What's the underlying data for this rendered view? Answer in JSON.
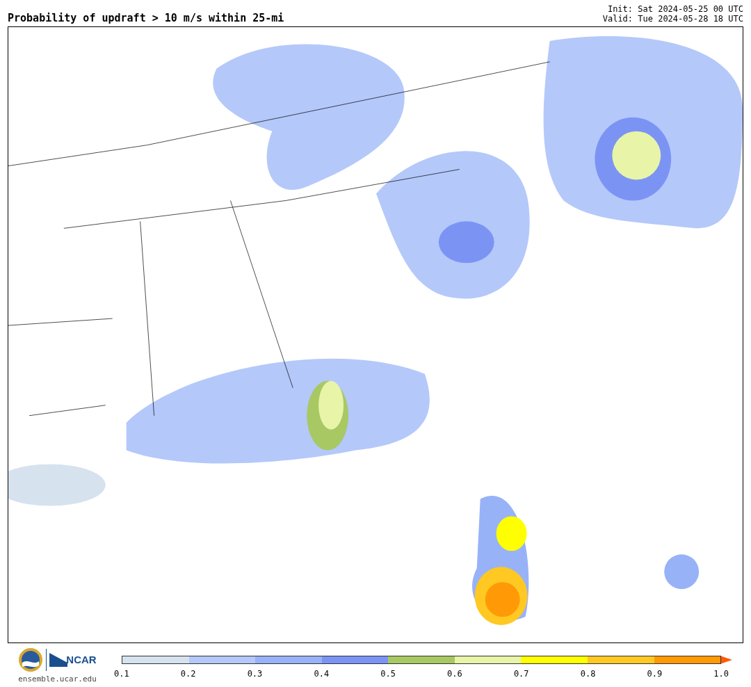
{
  "title": "Probability of updraft > 10 m/s within 25-mi",
  "init": "Init: Sat 2024-05-25 00 UTC",
  "valid": "Valid: Tue 2024-05-28 18 UTC",
  "footer": {
    "logo_text": "NCAR",
    "site": "ensemble.ucar.edu"
  },
  "colorbar": {
    "segments": [
      {
        "color": "#d6e2ee"
      },
      {
        "color": "#b4c8fa"
      },
      {
        "color": "#98b2f8"
      },
      {
        "color": "#7b94f4"
      },
      {
        "color": "#a8c864"
      },
      {
        "color": "#e8f4a8"
      },
      {
        "color": "#ffff00"
      },
      {
        "color": "#ffc822"
      },
      {
        "color": "#ff9a06"
      }
    ],
    "arrow": {
      "color": "#ff5a0a"
    },
    "ticks": [
      "0.1",
      "0.2",
      "0.3",
      "0.4",
      "0.5",
      "0.6",
      "0.7",
      "0.8",
      "0.9",
      "1.0"
    ]
  }
}
